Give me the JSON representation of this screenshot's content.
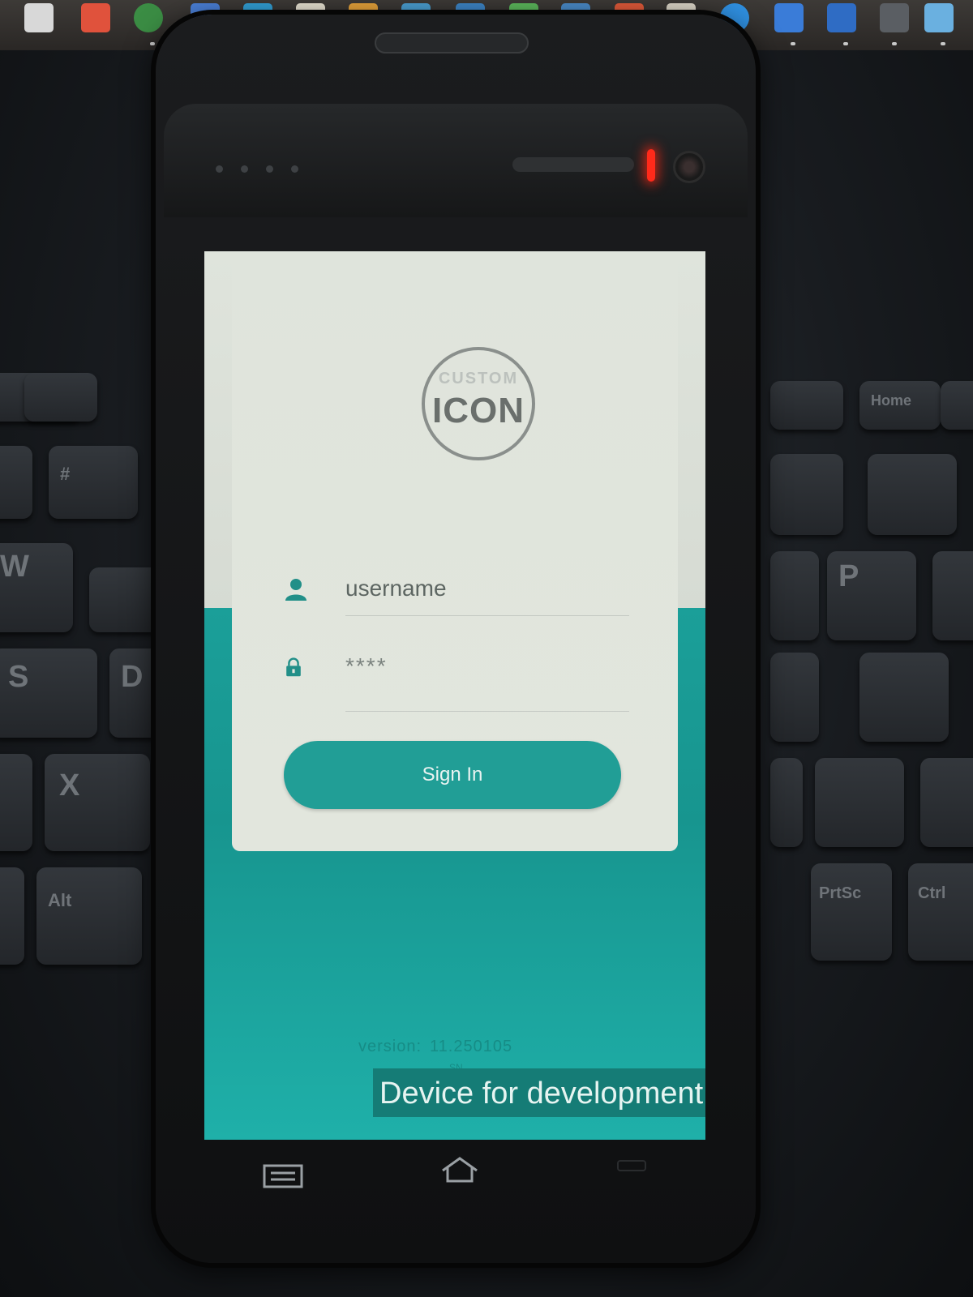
{
  "login": {
    "logo_top_text": "CUSTOM",
    "logo_main_text": "ICON",
    "username_placeholder": "username",
    "password_value": "****",
    "signin_label": "Sign In",
    "version_label": "version:",
    "version_value": "11.250105",
    "sn_label": "SN",
    "dev_banner": "Device for development"
  },
  "navigation": {
    "menu_icon": "menu-icon",
    "home_icon": "home-icon",
    "back_icon": "back-icon"
  },
  "keyboard": {
    "keys": [
      "W",
      "S",
      "D",
      "X",
      "Alt",
      "P",
      "PrtSc",
      "Ctrl",
      "Home",
      "#"
    ]
  },
  "colors": {
    "accent": "#219e96",
    "teal_background": "#1da39c",
    "card_background": "#e0e5dc",
    "banner_background": "#157c76",
    "led": "#ff2a1a"
  }
}
